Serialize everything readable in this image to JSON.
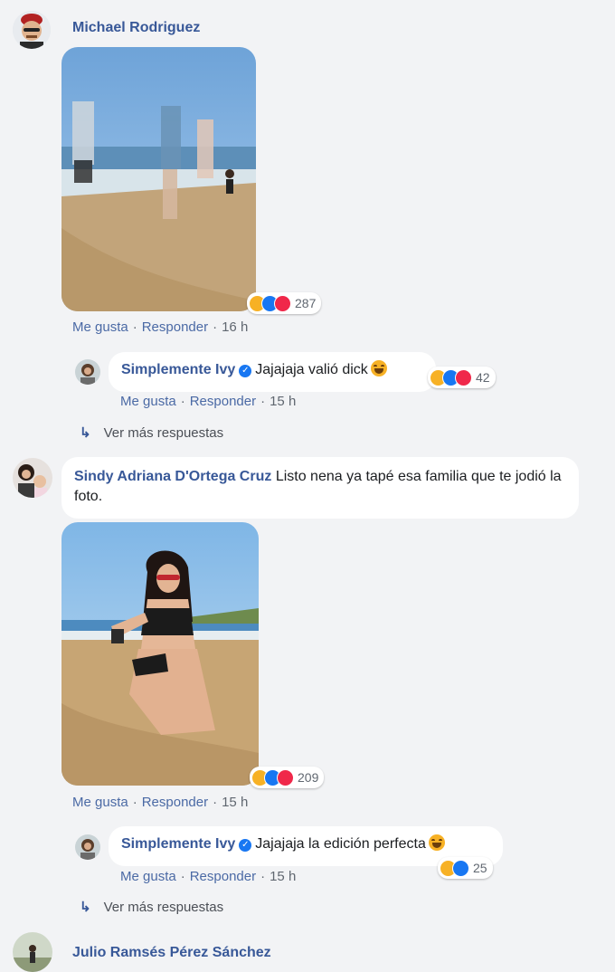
{
  "comments": [
    {
      "author": "Michael Rodriguez",
      "reactions": {
        "count": "287",
        "types": [
          "haha-icon",
          "like-icon",
          "love-icon"
        ]
      },
      "actions": {
        "like": "Me gusta",
        "reply": "Responder",
        "time": "16 h"
      },
      "reply": {
        "author": "Simplemente Ivy",
        "text": "Jajajaja valió dick",
        "reactions": {
          "count": "42"
        },
        "actions": {
          "like": "Me gusta",
          "reply": "Responder",
          "time": "15 h"
        }
      },
      "more_replies": "Ver más respuestas"
    },
    {
      "author": "Sindy Adriana D'Ortega Cruz",
      "text": "Listo nena ya tapé esa familia que te jodió la foto.",
      "reactions": {
        "count": "209"
      },
      "actions": {
        "like": "Me gusta",
        "reply": "Responder",
        "time": "15 h"
      },
      "reply": {
        "author": "Simplemente Ivy",
        "text": "Jajajaja la edición perfecta",
        "reactions": {
          "count": "25"
        },
        "actions": {
          "like": "Me gusta",
          "reply": "Responder",
          "time": "15 h"
        }
      },
      "more_replies": "Ver más respuestas"
    },
    {
      "author": "Julio Ramsés Pérez Sánchez"
    }
  ],
  "colors": {
    "link": "#385898",
    "meta": "#606770",
    "haha": "#f7b125",
    "like": "#1877f2",
    "love": "#f0284a"
  }
}
